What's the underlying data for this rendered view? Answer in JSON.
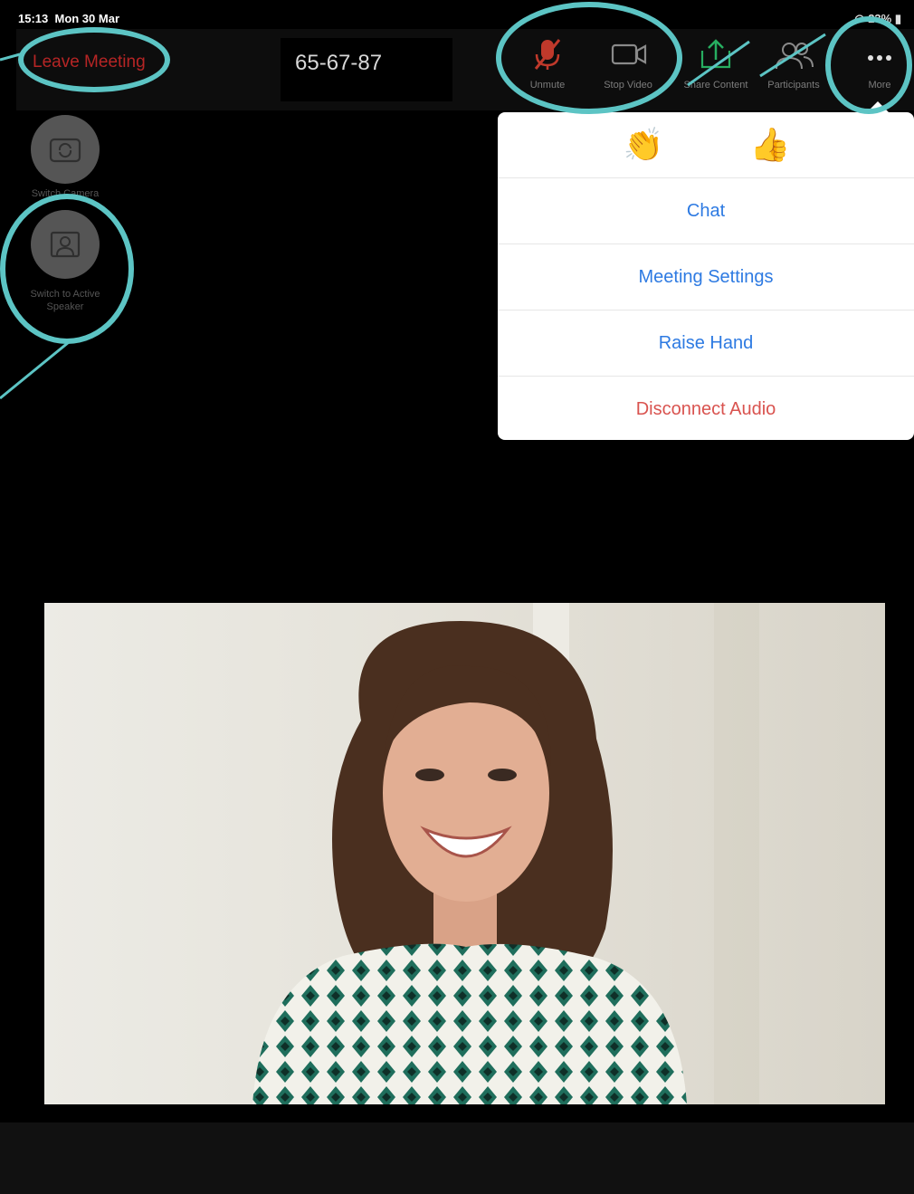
{
  "status": {
    "time": "15:13",
    "date": "Mon 30 Mar",
    "battery": "23%"
  },
  "toolbar": {
    "leave_label": "Leave Meeting",
    "meeting_id": "65-67-87",
    "unmute_label": "Unmute",
    "stop_video_label": "Stop Video",
    "share_label": "Share Content",
    "participants_label": "Participants",
    "more_label": "More"
  },
  "side": {
    "switch_camera_label": "Switch Camera",
    "switch_speaker_label": "Switch to Active Speaker"
  },
  "menu": {
    "reactions": [
      {
        "icon": "clapping-hands-icon",
        "glyph": "👏"
      },
      {
        "icon": "thumbs-up-icon",
        "glyph": "👍"
      }
    ],
    "items": [
      {
        "label": "Chat",
        "style": "primary"
      },
      {
        "label": "Meeting Settings",
        "style": "primary"
      },
      {
        "label": "Raise Hand",
        "style": "primary"
      },
      {
        "label": "Disconnect Audio",
        "style": "danger"
      }
    ]
  },
  "colors": {
    "accent": "#2d7ae2",
    "danger": "#d9534f",
    "leave": "#b62525",
    "annotation": "#5cc4c4",
    "mic_muted": "#c0392b",
    "share_green": "#27ae60"
  }
}
